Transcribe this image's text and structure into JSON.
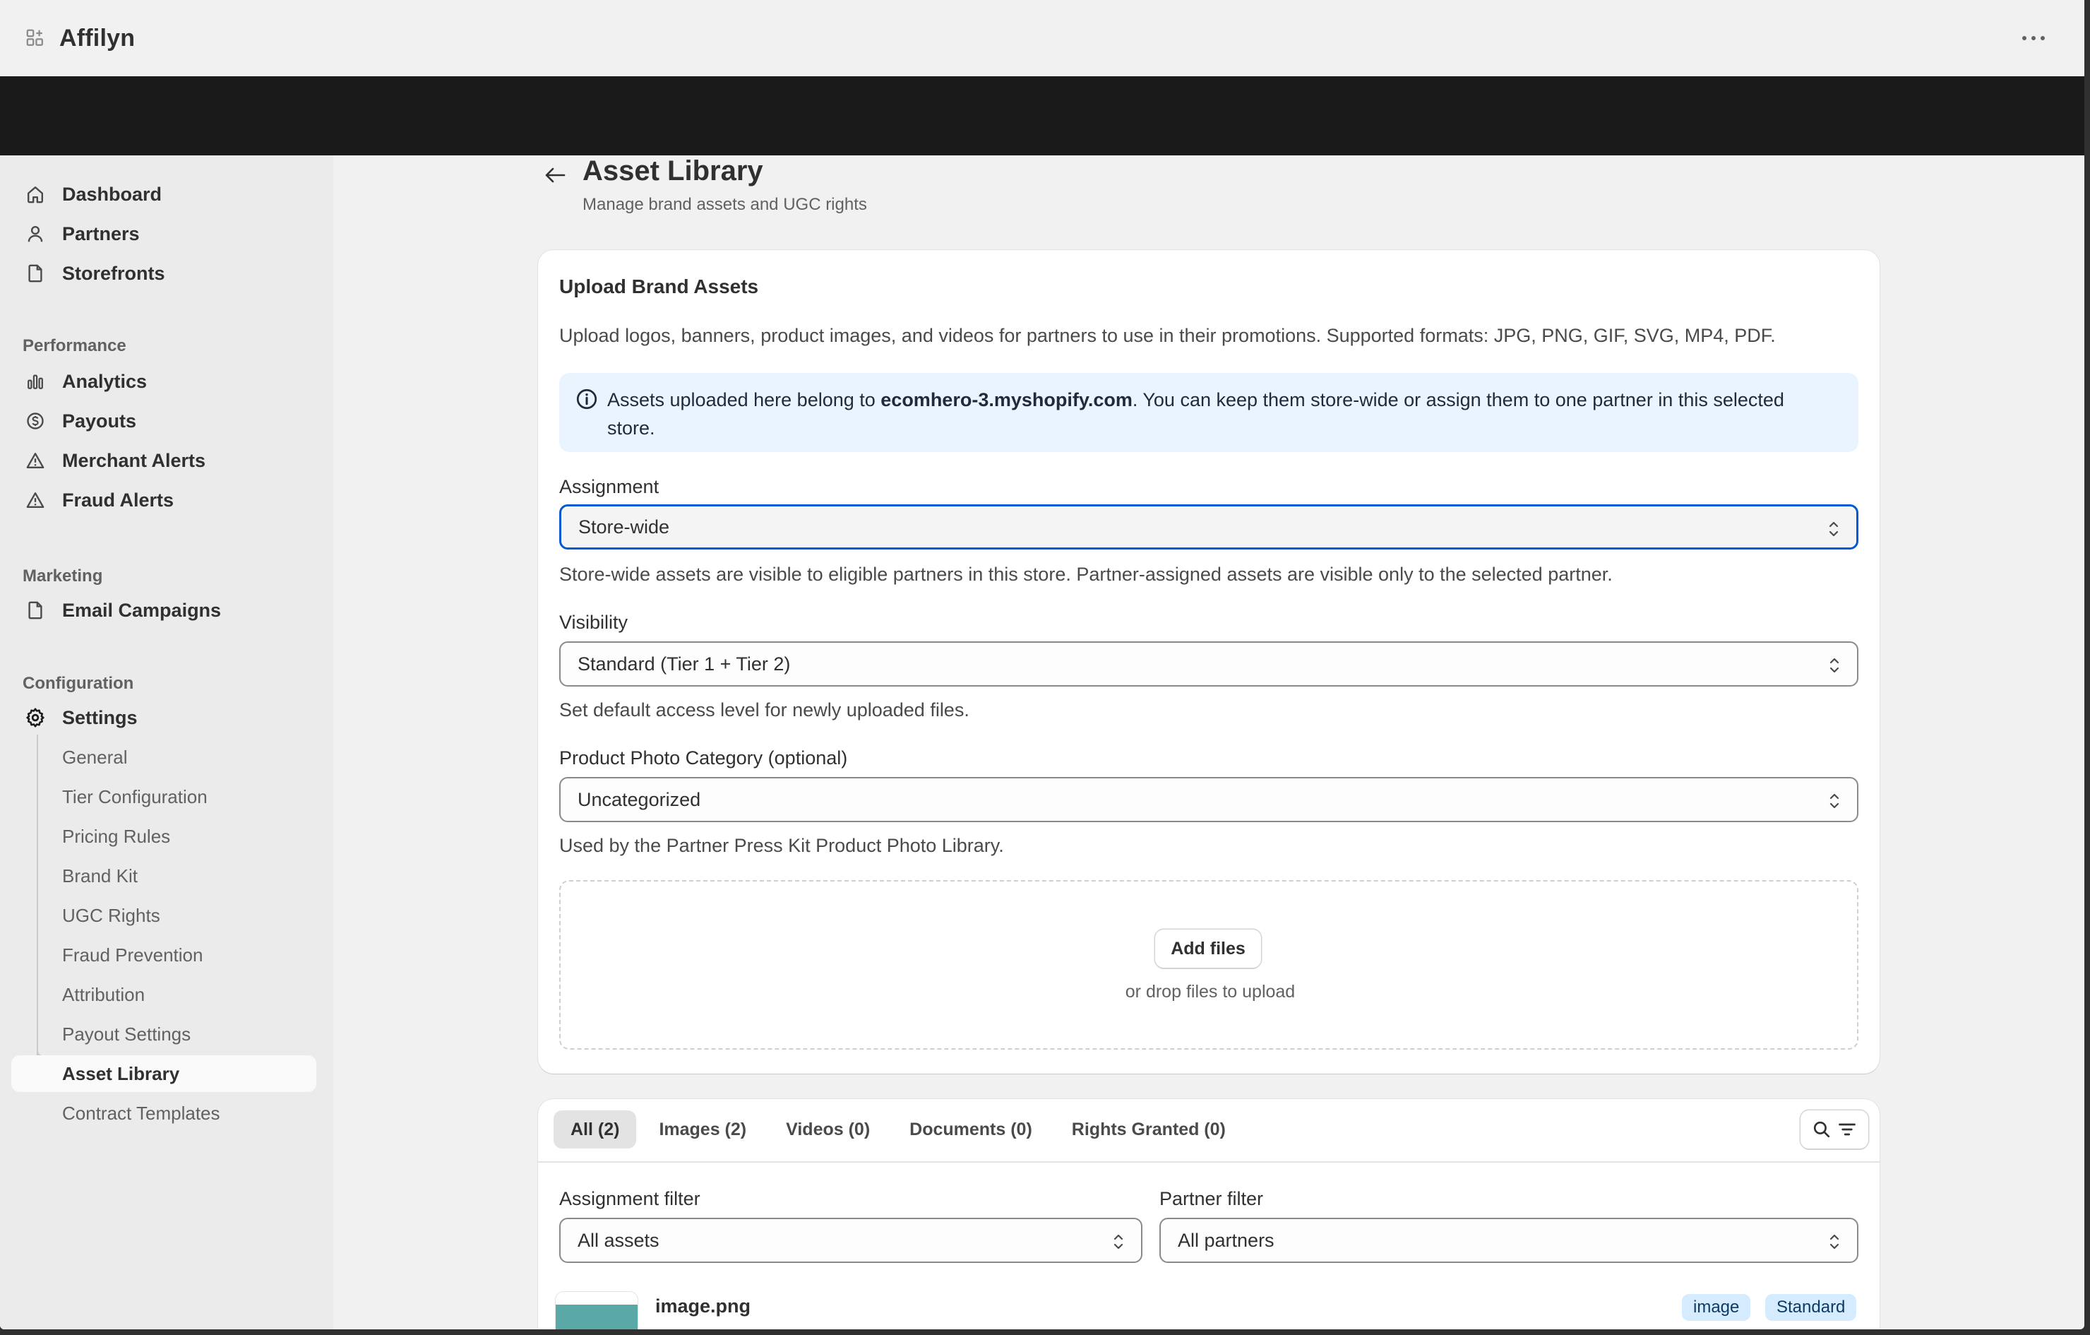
{
  "app": {
    "title": "Affilyn",
    "icon": "app-grid-icon",
    "more_icon": "more-horizontal-icon"
  },
  "sidebar": {
    "primary": [
      {
        "label": "Dashboard",
        "icon": "home-icon"
      },
      {
        "label": "Partners",
        "icon": "person-icon"
      },
      {
        "label": "Storefronts",
        "icon": "page-icon"
      }
    ],
    "sections": {
      "performance": "Performance",
      "marketing": "Marketing",
      "configuration": "Configuration"
    },
    "performance": [
      {
        "label": "Analytics",
        "icon": "bar-chart-icon"
      },
      {
        "label": "Payouts",
        "icon": "dollar-circle-icon"
      },
      {
        "label": "Merchant Alerts",
        "icon": "alert-triangle-icon"
      },
      {
        "label": "Fraud Alerts",
        "icon": "alert-triangle-icon"
      }
    ],
    "marketing": [
      {
        "label": "Email Campaigns",
        "icon": "page-icon"
      }
    ],
    "configuration": [
      {
        "label": "Settings",
        "icon": "gear-icon"
      }
    ],
    "settings_sub": [
      "General",
      "Tier Configuration",
      "Pricing Rules",
      "Brand Kit",
      "UGC Rights",
      "Fraud Prevention",
      "Attribution",
      "Payout Settings",
      "Asset Library",
      "Contract Templates"
    ],
    "active_sub": "Asset Library"
  },
  "page": {
    "title": "Asset Library",
    "subtitle": "Manage brand assets and UGC rights"
  },
  "upload": {
    "title": "Upload Brand Assets",
    "description": "Upload logos, banners, product images, and videos for partners to use in their promotions. Supported formats: JPG, PNG, GIF, SVG, MP4, PDF.",
    "info": {
      "prefix": "Assets uploaded here belong to ",
      "store": "ecomhero-3.myshopify.com",
      "suffix": ". You can keep them store-wide or assign them to one partner in this selected store."
    },
    "assignment": {
      "label": "Assignment",
      "value": "Store-wide",
      "help": "Store-wide assets are visible to eligible partners in this store. Partner-assigned assets are visible only to the selected partner."
    },
    "visibility": {
      "label": "Visibility",
      "value": "Standard (Tier 1 + Tier 2)",
      "help": "Set default access level for newly uploaded files."
    },
    "category": {
      "label": "Product Photo Category (optional)",
      "value": "Uncategorized",
      "help": "Used by the Partner Press Kit Product Photo Library."
    },
    "dropzone": {
      "button": "Add files",
      "hint": "or drop files to upload"
    }
  },
  "library": {
    "tabs": [
      {
        "label": "All (2)",
        "selected": true
      },
      {
        "label": "Images (2)",
        "selected": false
      },
      {
        "label": "Videos (0)",
        "selected": false
      },
      {
        "label": "Documents (0)",
        "selected": false
      },
      {
        "label": "Rights Granted (0)",
        "selected": false
      }
    ],
    "assignment_filter": {
      "label": "Assignment filter",
      "value": "All assets"
    },
    "partner_filter": {
      "label": "Partner filter",
      "value": "All partners"
    },
    "assets": [
      {
        "name": "image.png",
        "badges": [
          "image",
          "Standard"
        ]
      }
    ]
  },
  "colors": {
    "focus": "#005bd3",
    "info_bg": "#eaf4ff",
    "badge_bg": "#d5ebff",
    "header_dark": "#1a1a1a"
  }
}
